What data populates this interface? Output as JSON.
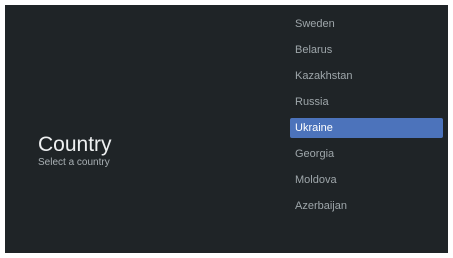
{
  "heading": {
    "title": "Country",
    "subtitle": "Select a country"
  },
  "countries": {
    "items": [
      {
        "label": "Sweden"
      },
      {
        "label": "Belarus"
      },
      {
        "label": "Kazakhstan"
      },
      {
        "label": "Russia"
      },
      {
        "label": "Ukraine",
        "selected": true
      },
      {
        "label": "Georgia"
      },
      {
        "label": "Moldova"
      },
      {
        "label": "Azerbaijan"
      }
    ]
  },
  "colors": {
    "background": "#1f2427",
    "highlight": "#4c73bb"
  }
}
